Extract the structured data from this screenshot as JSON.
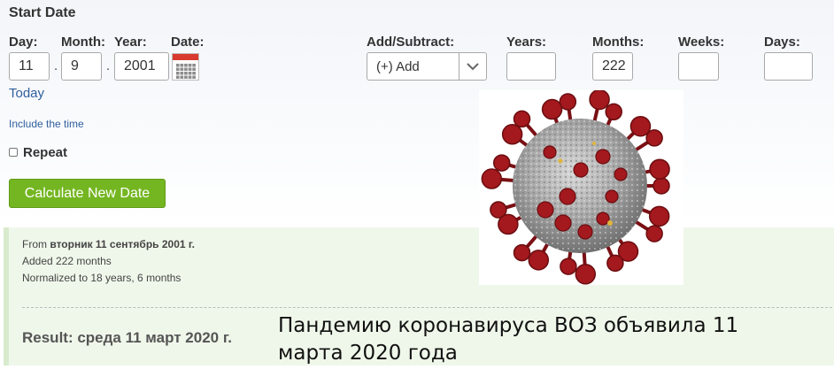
{
  "start_date": {
    "heading": "Start Date",
    "day_label": "Day:",
    "month_label": "Month:",
    "year_label": "Year:",
    "date_label": "Date:",
    "day_value": "11",
    "month_value": "9",
    "year_value": "2001",
    "separator": ".",
    "today_link": "Today",
    "include_time_link": "Include the time",
    "repeat_label": "Repeat"
  },
  "add_subtract": {
    "label": "Add/Subtract:",
    "selected": "(+) Add",
    "years_label": "Years:",
    "months_label": "Months:",
    "weeks_label": "Weeks:",
    "days_label": "Days:",
    "years_value": "",
    "months_value": "222",
    "weeks_value": "",
    "days_value": ""
  },
  "calculate_button": "Calculate New Date",
  "result_panel": {
    "from_prefix": "From ",
    "from_date": "вторник 11 сентябрь 2001 г.",
    "added": "Added 222 months",
    "normalized": "Normalized to 18 years, 6 months",
    "result": "Result: среда 11 март 2020 г."
  },
  "caption": "Пандемию коронавируса ВОЗ объявила 11 марта 2020 года",
  "colors": {
    "button_green": "#74b621",
    "link_blue": "#2f5f9e",
    "panel_bg": "#eff7ea",
    "virus_red": "#a3191e",
    "virus_grey": "#9a9a9a"
  },
  "icons": [
    "calendar-icon",
    "chevron-down-icon",
    "checkbox-icon",
    "coronavirus-image"
  ]
}
